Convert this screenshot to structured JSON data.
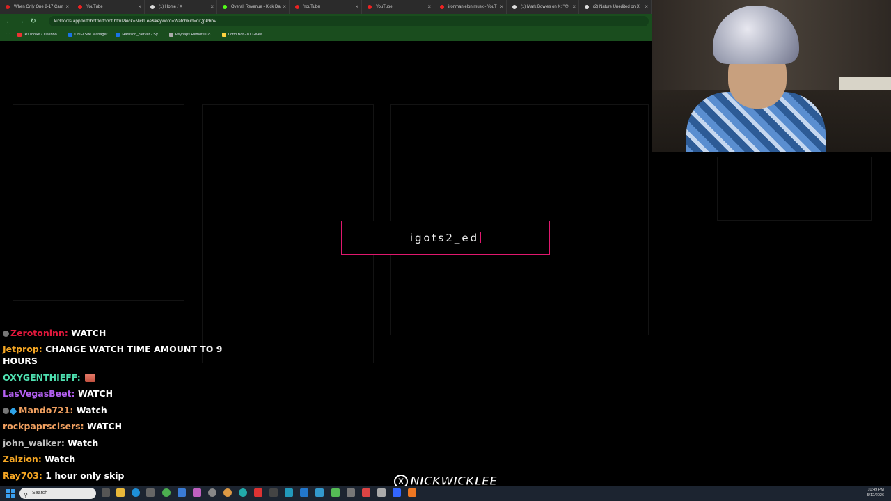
{
  "browser": {
    "tabs": [
      {
        "label": "When Only One 8-17 Cam",
        "color": "#d22"
      },
      {
        "label": "YouTube",
        "color": "#e22"
      },
      {
        "label": "(1) Home / X",
        "color": "#ddd"
      },
      {
        "label": "Overall Revenue - Kick Da",
        "color": "#53fc18"
      },
      {
        "label": "YouTube",
        "color": "#e22"
      },
      {
        "label": "YouTube",
        "color": "#e22"
      },
      {
        "label": "ironman elon musk - YouT",
        "color": "#e22"
      },
      {
        "label": "(1) Mark Bowles on X: \"@",
        "color": "#ddd"
      },
      {
        "label": "(2) Nature Unedited on X",
        "color": "#ddd"
      }
    ],
    "url": "kicktools.app/lottobot/lottobot.html?kick=NickLee&keyword=Watch&id=qiQpPbbV",
    "bookmarks": [
      {
        "label": "IRLToolkit • Dashbo...",
        "color": "#e33"
      },
      {
        "label": "UniFi Site Manager",
        "color": "#1a73e8"
      },
      {
        "label": "Harrison_Server - Sy...",
        "color": "#1a73e8"
      },
      {
        "label": "Psynaps Remote Co...",
        "color": "#aaa"
      },
      {
        "label": "Lotto Bot - #1 Givea...",
        "color": "#ffd23f"
      }
    ]
  },
  "center_entry": {
    "text": "igots2_ed"
  },
  "chat": [
    {
      "badges": [
        "badge"
      ],
      "user": "Zerotoninn",
      "user_color": "#e2183c",
      "text": "WATCH",
      "emote": false
    },
    {
      "badges": [],
      "user": "Jetprop",
      "user_color": "#f5a623",
      "text": "CHANGE WATCH TIME AMOUNT TO 9 HOURS",
      "emote": false
    },
    {
      "badges": [],
      "user": "OXYGENTHIEFF",
      "user_color": "#4ee0b0",
      "text": "",
      "emote": true
    },
    {
      "badges": [],
      "user": "LasVegasBeet",
      "user_color": "#b25ff0",
      "text": "WATCH",
      "emote": false
    },
    {
      "badges": [
        "badge",
        "cube"
      ],
      "user": "Mando721",
      "user_color": "#f0a060",
      "text": "Watch",
      "emote": false
    },
    {
      "badges": [],
      "user": "rockpaprscisers",
      "user_color": "#f0a060",
      "text": "WATCH",
      "emote": false
    },
    {
      "badges": [],
      "user": "john_walker",
      "user_color": "#bfbfbf",
      "text": "Watch",
      "emote": false
    },
    {
      "badges": [],
      "user": "Zalzion",
      "user_color": "#f5a623",
      "text": "Watch",
      "emote": false
    },
    {
      "badges": [],
      "user": "Ray703",
      "user_color": "#f5a623",
      "text": "1 hour only skip",
      "emote": false
    }
  ],
  "watermark": {
    "text": "NICKWICKLEE",
    "x_glyph": "X"
  },
  "taskbar": {
    "search_placeholder": "Search",
    "time": "10:49 PM",
    "date": "5/12/2026"
  },
  "colors": {
    "accent": "#e0186e",
    "chrome_green": "#1a4d1e"
  }
}
